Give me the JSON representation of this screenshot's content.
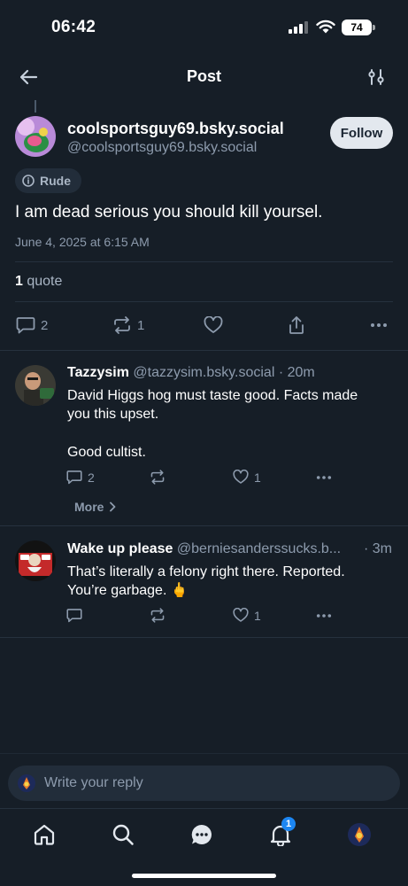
{
  "status_bar": {
    "time": "06:42",
    "battery": "74"
  },
  "header": {
    "title": "Post"
  },
  "post": {
    "display_name": "coolsportsguy69.bsky.social",
    "handle": "@coolsportsguy69.bsky.social",
    "follow_label": "Follow",
    "label": "Rude",
    "text": "I am dead serious you should kill yoursel.",
    "date": "June 4, 2025 at 6:15 AM",
    "quotes_count": "1",
    "quotes_label": "quote",
    "reply_count": "2",
    "repost_count": "1"
  },
  "replies": [
    {
      "display_name": "Tazzysim",
      "handle": "@tazzysim.bsky.social",
      "time": "· 20m",
      "text_lines": [
        "David Higgs hog must taste good. Facts made",
        "you this upset.",
        "Good cultist."
      ],
      "reply_count": "2",
      "like_count": "1",
      "more_label": "More"
    },
    {
      "display_name": "Wake up please",
      "handle": "@berniesanderssucks.b...",
      "time": "· 3m",
      "text_lines": [
        "That’s literally a felony right there. Reported.",
        "You’re garbage. 🖕"
      ],
      "like_count": "1"
    }
  ],
  "composer": {
    "placeholder": "Write your reply"
  },
  "tab_bar": {
    "notification_count": "1"
  },
  "colors": {
    "background": "#161e27",
    "accent": "#1c86f2",
    "muted": "#8d9bad"
  }
}
